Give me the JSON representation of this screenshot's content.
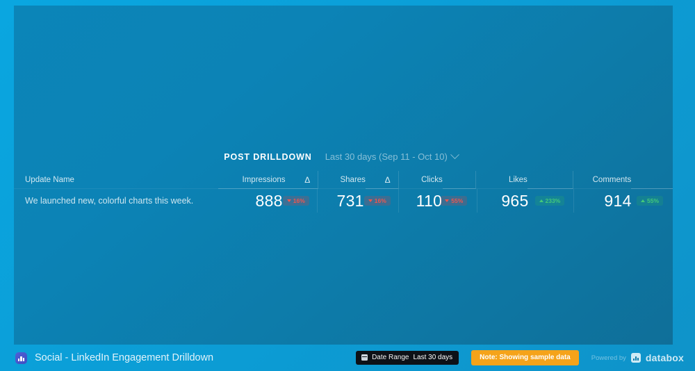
{
  "widget": {
    "title": "POST DRILLDOWN",
    "date_picker": {
      "label": "Last 30 days (Sep 11 - Oct 10)",
      "icon": "chevron-down-icon"
    }
  },
  "table": {
    "columns": [
      {
        "key": "update_name",
        "label": "Update Name"
      },
      {
        "key": "impressions",
        "label": "Impressions"
      },
      {
        "key": "impressions_delta",
        "label": "Δ"
      },
      {
        "key": "shares",
        "label": "Shares"
      },
      {
        "key": "shares_delta",
        "label": "Δ"
      },
      {
        "key": "clicks",
        "label": "Clicks"
      },
      {
        "key": "likes",
        "label": "Likes"
      },
      {
        "key": "comments",
        "label": "Comments"
      }
    ],
    "rows": [
      {
        "update_name": "We launched new, colorful charts this week.",
        "impressions": "888",
        "impressions_delta": "16%",
        "impressions_delta_dir": "down",
        "shares": "731",
        "shares_delta": "16%",
        "shares_delta_dir": "down",
        "clicks": "110",
        "clicks_delta": "55%",
        "clicks_delta_dir": "down",
        "likes": "965",
        "likes_delta": "233%",
        "likes_delta_dir": "up",
        "comments": "914",
        "comments_delta": "55%",
        "comments_delta_dir": "up"
      }
    ]
  },
  "footer": {
    "brand_icon": "databox-app-icon",
    "board_title": "Social - LinkedIn Engagement Drilldown",
    "date_range": {
      "icon": "calendar-icon",
      "label": "Date Range",
      "value": "Last 30 days"
    },
    "sample_note": "Note: Showing sample data",
    "powered_by_label": "Powered by",
    "powered_by_brand": "databox",
    "powered_by_icon": "databox-logo-icon"
  },
  "colors": {
    "page_background": "#0aa6e0",
    "panel_background": "#0c83b6",
    "delta_down": "#f0564e",
    "delta_up": "#44c97a",
    "sample_badge": "#f5a31a",
    "chip_background": "#0d1117"
  }
}
